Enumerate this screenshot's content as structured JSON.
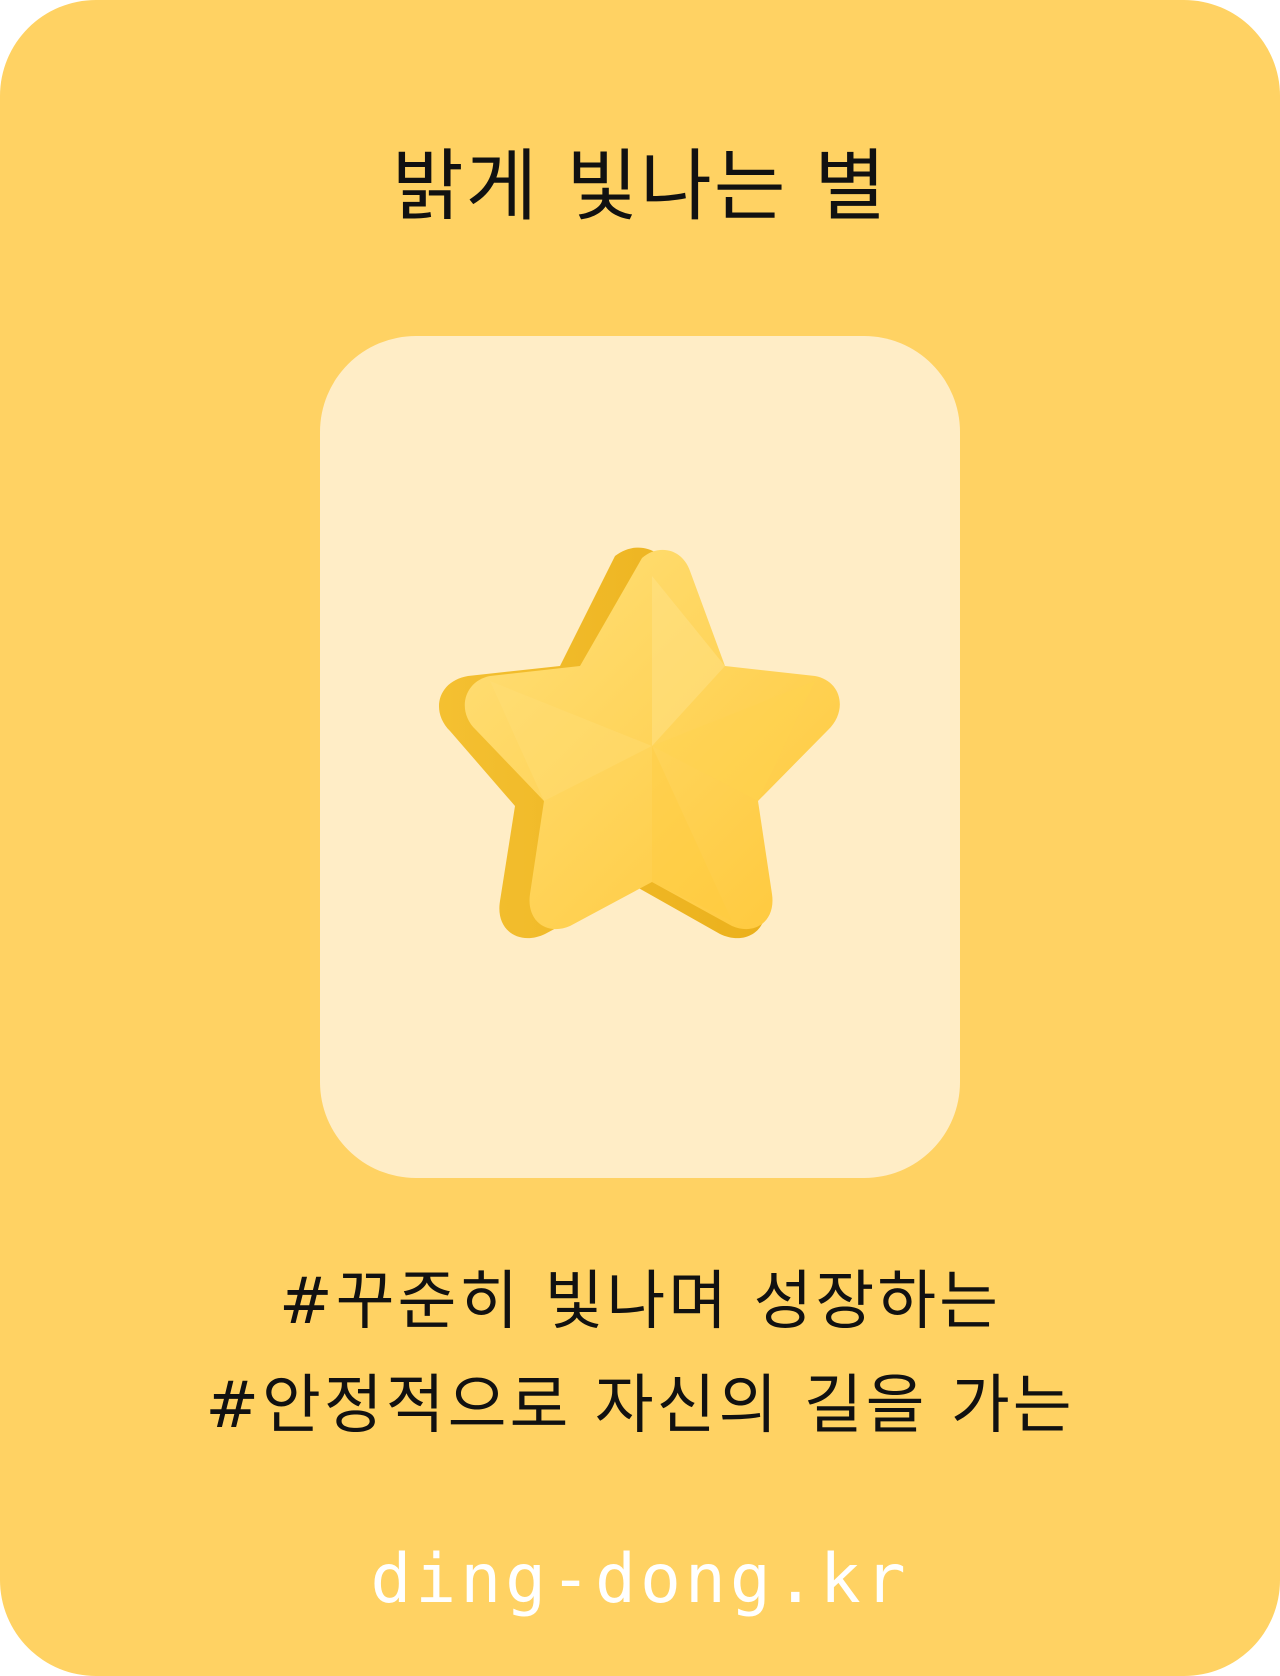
{
  "card": {
    "title": "밝게 빛나는 별",
    "image": {
      "icon": "star-icon",
      "colors": {
        "star_face": "#ffd84f",
        "star_side": "#efb51e",
        "panel": "#ffedc6"
      }
    },
    "tags": [
      "#꾸준히 빛나며 성장하는",
      "#안정적으로 자신의 길을 가는"
    ],
    "footer": "ding-dong.kr"
  },
  "colors": {
    "background": "#ffd263",
    "text": "#111111",
    "footer_text": "#ffffff"
  }
}
